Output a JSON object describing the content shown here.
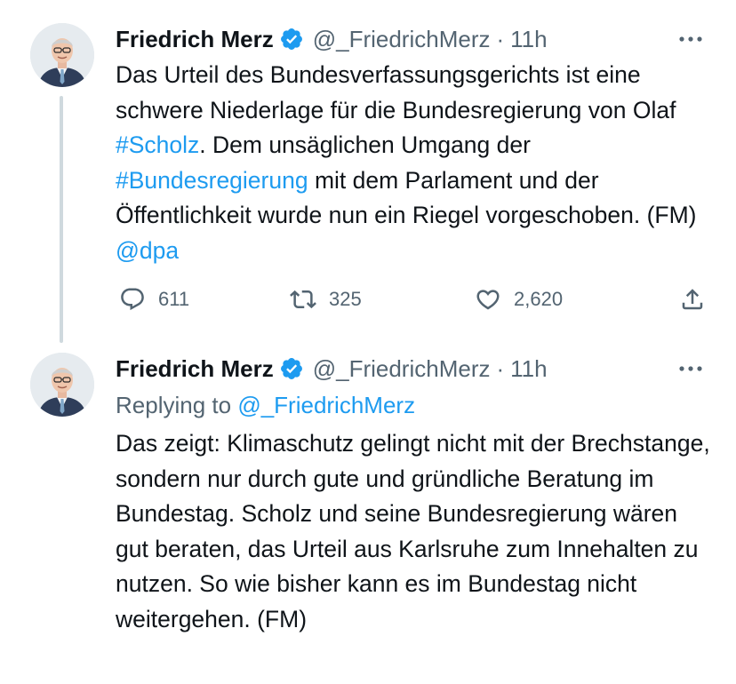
{
  "tweets": [
    {
      "author_name": "Friedrich Merz",
      "handle": "@_FriedrichMerz",
      "separator": "·",
      "time": "11h",
      "text_segments": [
        {
          "text": "Das Urteil des Bundesverfassungsgerichts ist eine schwere Niederlage für die Bundesregierung von Olaf ",
          "link": false
        },
        {
          "text": "#Scholz",
          "link": true
        },
        {
          "text": ". Dem unsäglichen Umgang der ",
          "link": false
        },
        {
          "text": "#Bundesregierung",
          "link": true
        },
        {
          "text": " mit dem Parlament und der Öffentlichkeit wurde nun ein Riegel vorgeschoben. (FM) ",
          "link": false
        },
        {
          "text": "@dpa",
          "link": true
        }
      ],
      "stats": {
        "replies": "611",
        "retweets": "325",
        "likes": "2,620"
      }
    },
    {
      "author_name": "Friedrich Merz",
      "handle": "@_FriedrichMerz",
      "separator": "·",
      "time": "11h",
      "replying_label": "Replying to",
      "replying_to": "@_FriedrichMerz",
      "text": "Das zeigt: Klimaschutz gelingt nicht mit der Brechstange, sondern nur durch gute und gründliche Beratung im Bundestag. Scholz und seine Bundesregierung wären gut beraten, das Urteil aus Karlsruhe zum Innehalten zu nutzen. So wie bisher kann es im Bundestag nicht weitergehen. (FM)"
    }
  ],
  "icons": {
    "verified": "verified-badge-icon",
    "more": "more-options-icon",
    "reply": "reply-icon",
    "retweet": "retweet-icon",
    "like": "like-icon",
    "share": "share-icon"
  },
  "colors": {
    "text": "#0f1419",
    "secondary": "#536471",
    "link": "#1d9bf0",
    "verified": "#1d9bf0",
    "thread_line": "#cfd9de"
  }
}
